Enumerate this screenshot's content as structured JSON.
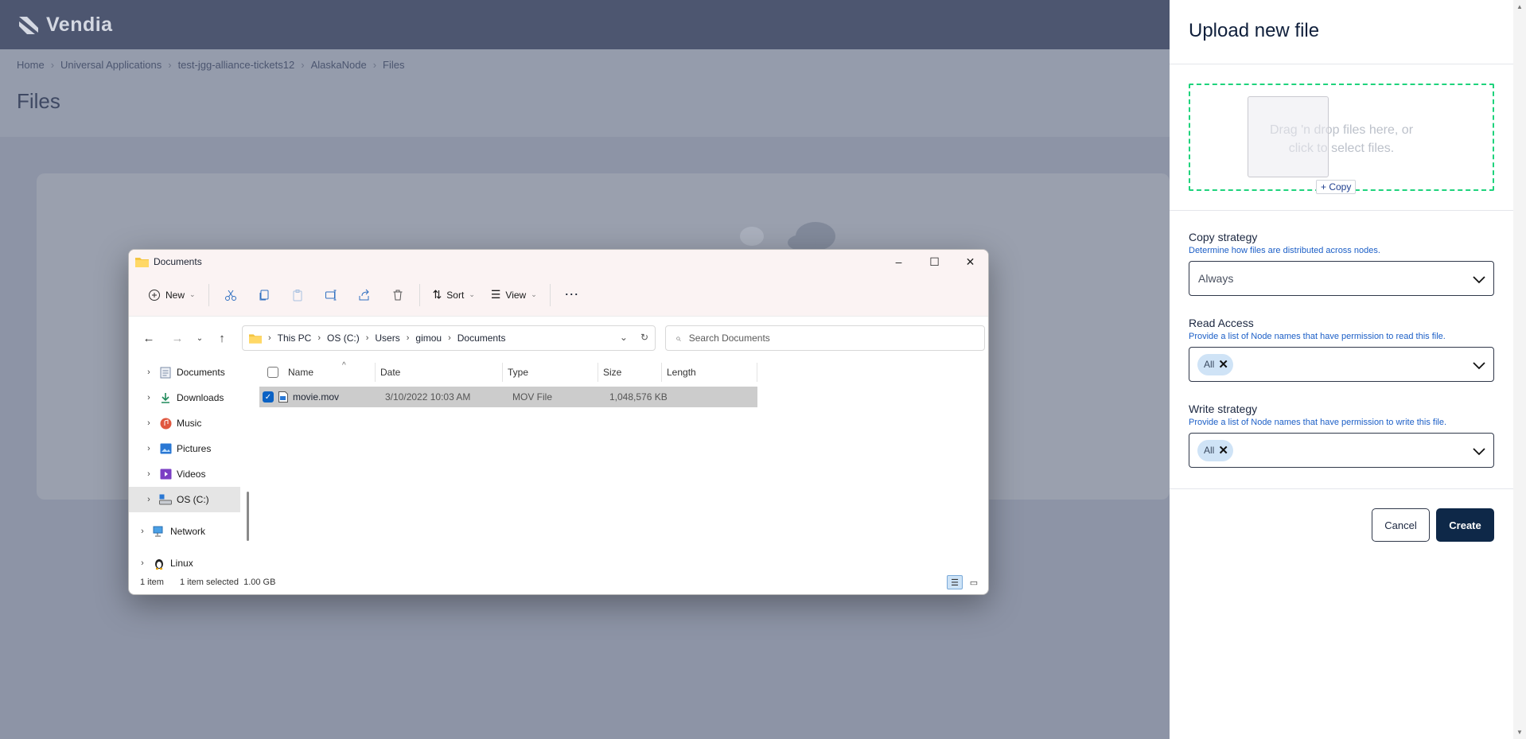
{
  "app": {
    "brand": "Vendia",
    "breadcrumb": [
      "Home",
      "Universal Applications",
      "test-jgg-alliance-tickets12",
      "AlaskaNode",
      "Files"
    ],
    "page_title": "Files"
  },
  "explorer": {
    "title": "Documents",
    "toolbar": {
      "new_label": "New",
      "sort_label": "Sort",
      "view_label": "View"
    },
    "address": [
      "This PC",
      "OS (C:)",
      "Users",
      "gimou",
      "Documents"
    ],
    "search_placeholder": "Search Documents",
    "nav_items": [
      {
        "label": "Documents",
        "icon": "documents-icon"
      },
      {
        "label": "Downloads",
        "icon": "downloads-icon"
      },
      {
        "label": "Music",
        "icon": "music-icon"
      },
      {
        "label": "Pictures",
        "icon": "pictures-icon"
      },
      {
        "label": "Videos",
        "icon": "videos-icon"
      },
      {
        "label": "OS (C:)",
        "icon": "drive-icon"
      },
      {
        "label": "Network",
        "icon": "network-icon"
      },
      {
        "label": "Linux",
        "icon": "linux-icon"
      }
    ],
    "columns": [
      "Name",
      "Date",
      "Type",
      "Size",
      "Length"
    ],
    "files": [
      {
        "name": "movie.mov",
        "date": "3/10/2022 10:03 AM",
        "type": "MOV File",
        "size": "1,048,576 KB",
        "length": ""
      }
    ],
    "status": {
      "count": "1 item",
      "selected": "1 item selected",
      "size": "1.00 GB"
    }
  },
  "drawer": {
    "title": "Upload new file",
    "dropzone_text": "Drag 'n drop files here, or click to select files.",
    "copy_tooltip": "+ Copy",
    "copy_strategy": {
      "label": "Copy strategy",
      "help": "Determine how files are distributed across nodes.",
      "value": "Always"
    },
    "read_access": {
      "label": "Read Access",
      "help": "Provide a list of Node names that have permission to read this file.",
      "chip": "All"
    },
    "write_strategy": {
      "label": "Write strategy",
      "help": "Provide a list of Node names that have permission to write this file.",
      "chip": "All"
    },
    "cancel_label": "Cancel",
    "create_label": "Create"
  },
  "colors": {
    "header": "#4d5670",
    "dropzone_border": "#1ed37c",
    "create_button": "#0e2848",
    "chip_bg": "#cfe3f6",
    "selection": "#0b62c4"
  }
}
